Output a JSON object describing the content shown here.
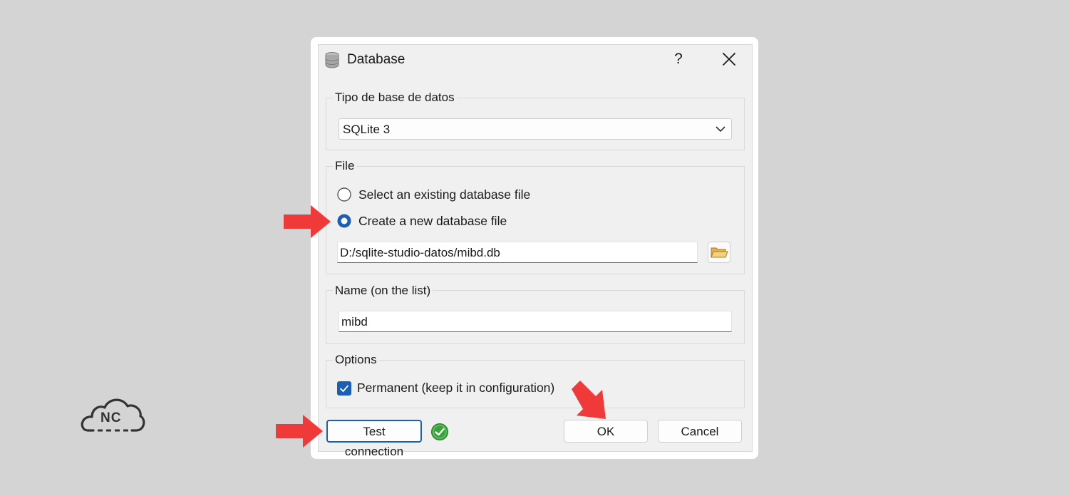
{
  "window": {
    "title": "Database",
    "help_label": "?",
    "icons": {
      "app": "database-icon",
      "close": "close-icon"
    }
  },
  "db_type": {
    "group_label": "Tipo de base de datos",
    "selected": "SQLite 3"
  },
  "file": {
    "group_label": "File",
    "option_existing": "Select an existing database file",
    "option_new": "Create a new database file",
    "selected_option": "new",
    "path": "D:/sqlite-studio-datos/mibd.db"
  },
  "name": {
    "group_label": "Name (on the list)",
    "value": "mibd"
  },
  "options": {
    "group_label": "Options",
    "permanent_label": "Permanent (keep it in configuration)",
    "permanent_checked": true
  },
  "buttons": {
    "test": "Test connection",
    "ok": "OK",
    "cancel": "Cancel"
  },
  "logo": {
    "text": "NC"
  },
  "colors": {
    "accent": "#1a5fb4",
    "annotation_arrow": "#f03a3a",
    "success": "#3aa33a"
  }
}
